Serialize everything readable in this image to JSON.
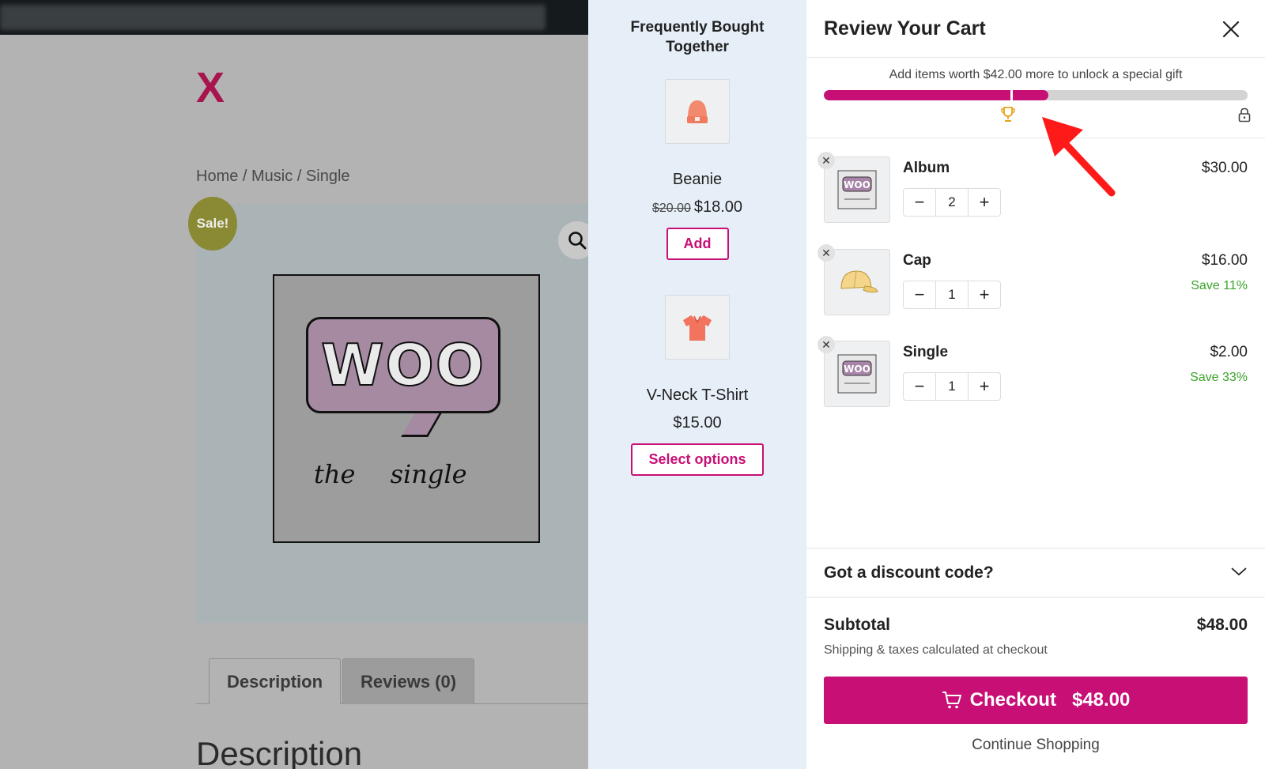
{
  "background_page": {
    "logo": "X",
    "breadcrumb": "Home / Music / Single",
    "sale_badge": "Sale!",
    "album_art": {
      "brand": "WOO",
      "caption": "the single"
    },
    "tabs": [
      {
        "label": "Description",
        "active": true
      },
      {
        "label": "Reviews (0)",
        "active": false
      }
    ],
    "section_heading": "Description"
  },
  "fbt": {
    "title_line1": "Frequently Bought",
    "title_line2": "Together",
    "items": [
      {
        "name": "Beanie",
        "old_price": "$20.00",
        "price": "$18.00",
        "button": "Add",
        "icon": "beanie-icon"
      },
      {
        "name": "V-Neck T-Shirt",
        "old_price": "",
        "price": "$15.00",
        "button": "Select options",
        "icon": "tshirt-icon"
      }
    ]
  },
  "cart": {
    "title": "Review Your Cart",
    "progress": {
      "message": "Add items worth $42.00 more to unlock a special gift",
      "fill_fraction": 0.53,
      "milestone_fraction": 0.44,
      "milestone_icon": "trophy-icon",
      "end_icon": "lock-icon"
    },
    "items": [
      {
        "name": "Album",
        "qty": "2",
        "price": "$30.00",
        "save": "",
        "thumb": "woo-album-thumb"
      },
      {
        "name": "Cap",
        "qty": "1",
        "price": "$16.00",
        "save": "Save 11%",
        "thumb": "cap-thumb"
      },
      {
        "name": "Single",
        "qty": "1",
        "price": "$2.00",
        "save": "Save 33%",
        "thumb": "woo-single-thumb"
      }
    ],
    "discount_label": "Got a discount code?",
    "subtotal_label": "Subtotal",
    "subtotal_value": "$48.00",
    "shipping_note": "Shipping & taxes calculated at checkout",
    "checkout_label": "Checkout",
    "checkout_amount": "$48.00",
    "continue_label": "Continue Shopping"
  },
  "colors": {
    "accent": "#c70f75",
    "save_green": "#3aa329",
    "fbt_bg": "#e6eff8",
    "trophy": "#e8a31c",
    "annotation_arrow": "#ff1a1a"
  }
}
